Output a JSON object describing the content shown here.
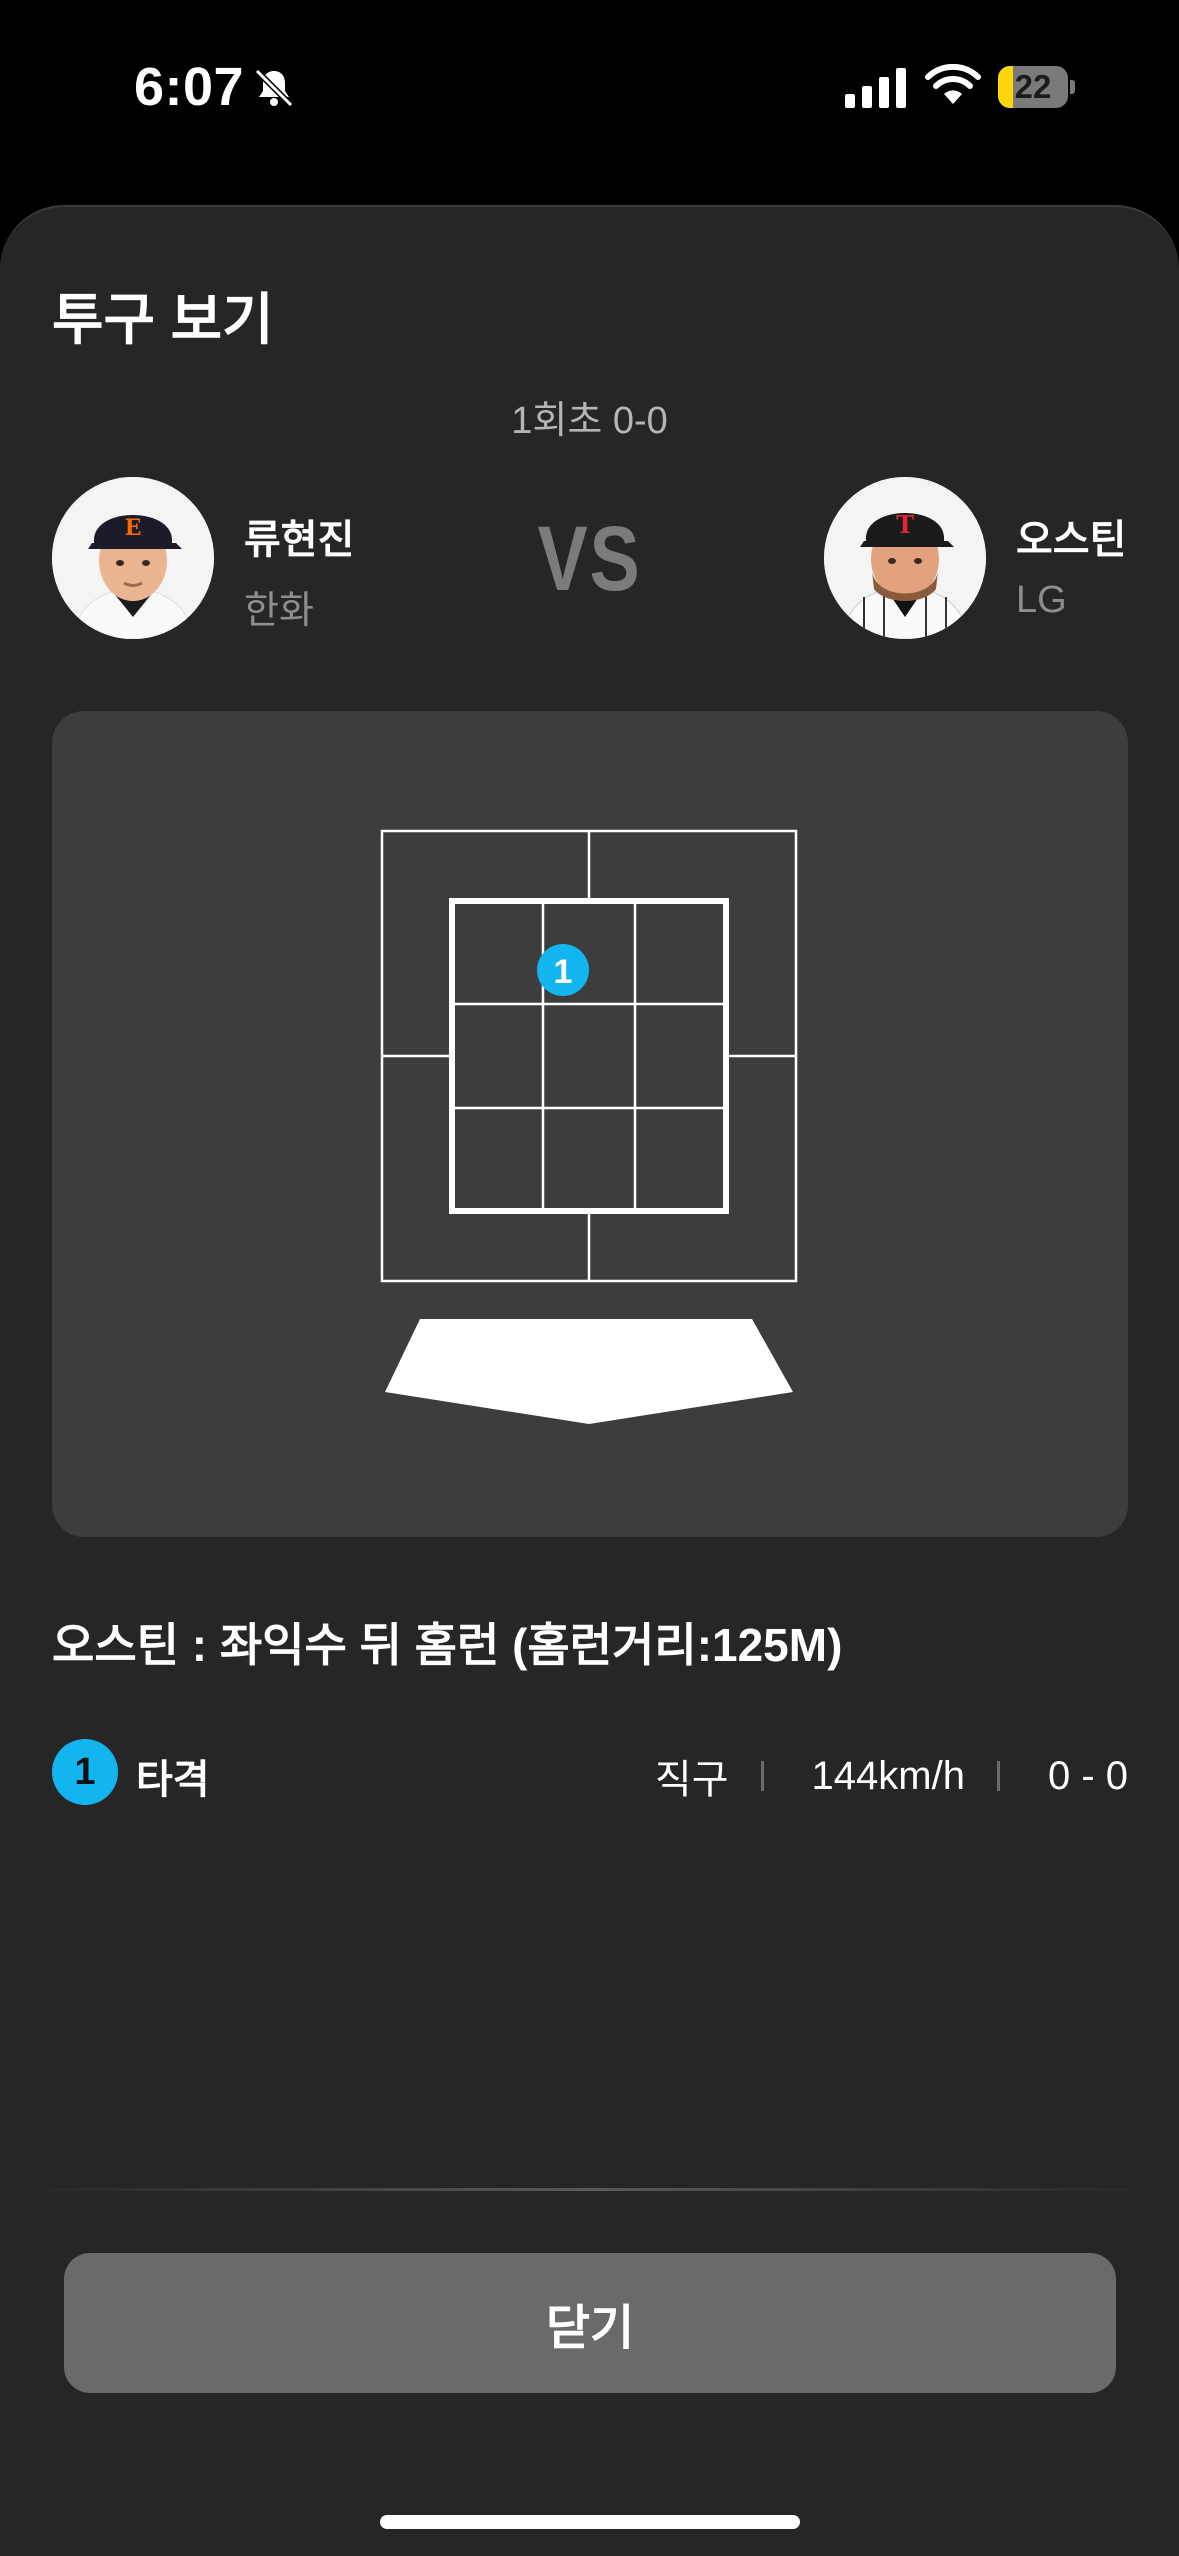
{
  "status_bar": {
    "time": "6:07",
    "battery_level": "22",
    "battery_color": "#ffd60a",
    "icons": [
      "bell-slash-icon",
      "cellular-signal-icon",
      "wifi-icon",
      "battery-icon"
    ]
  },
  "sheet": {
    "title": "투구 보기",
    "inning": "1회초 0-0"
  },
  "pitcher": {
    "name": "류현진",
    "team": "한화"
  },
  "vs_label": "VS",
  "batter": {
    "name": "오스틴",
    "team": "LG"
  },
  "strike_zone": {
    "pitches": [
      {
        "number": "1",
        "zone_cell": "top-middle",
        "color": "#12b5f0"
      }
    ]
  },
  "result_text": "오스틴 : 좌익수 뒤 홈런 (홈런거리:125M)",
  "pitch_list": [
    {
      "number": "1",
      "label": "타격",
      "pitch_type": "직구",
      "speed": "144km/h",
      "count": "0 - 0"
    }
  ],
  "close_button": {
    "label": "닫기"
  },
  "colors": {
    "background": "#000000",
    "sheet": "#262626",
    "panel": "#3d3d3d",
    "accent": "#12b5f0",
    "button": "#6a6a6a"
  }
}
